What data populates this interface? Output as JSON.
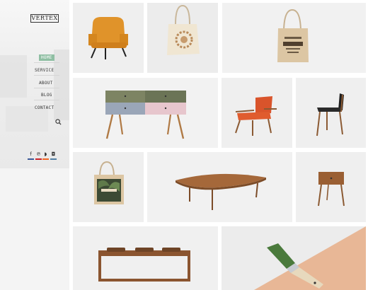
{
  "brand": {
    "logo_text": "VERTEX"
  },
  "nav": {
    "items": [
      {
        "label": "HOME",
        "active": true
      },
      {
        "label": "SERVICE",
        "active": false
      },
      {
        "label": "ABOUT",
        "active": false
      },
      {
        "label": "BLOG",
        "active": false
      },
      {
        "label": "CONTACT",
        "active": false
      }
    ]
  },
  "social": [
    {
      "icon": "facebook-icon",
      "glyph": "f",
      "color": "#3b5998"
    },
    {
      "icon": "pinterest-icon",
      "glyph": "℗",
      "color": "#cb2027"
    },
    {
      "icon": "rss-icon",
      "glyph": "◗",
      "color": "#f26522"
    },
    {
      "icon": "instagram-icon",
      "glyph": "◘",
      "color": "#517fa4"
    }
  ],
  "accent": "#8fbfa3",
  "gallery": [
    "orange-armchair-image",
    "tote-bag-floral-image",
    "tote-bag-print-image",
    "two-tone-sideboard-image",
    "orange-lounge-chair-image",
    "black-dining-chair-image",
    "tote-bag-tropical-image",
    "wood-coffee-table-image",
    "wood-nightstand-image",
    "wood-bench-image",
    "paint-brush-image"
  ]
}
